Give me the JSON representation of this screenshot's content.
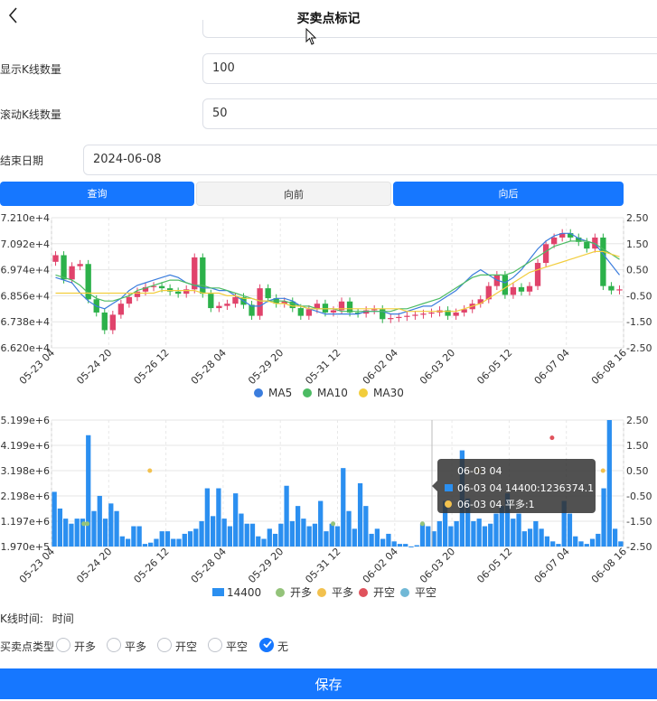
{
  "header": {
    "title": "买卖点标记"
  },
  "form": {
    "kline_count": {
      "label": "显示K线数量",
      "value": "100"
    },
    "scroll_count": {
      "label": "滚动K线数量",
      "value": "50"
    },
    "end_date": {
      "label": "结束日期",
      "value": "2024-06-08"
    }
  },
  "buttons": {
    "query": "查询",
    "forward": "向前",
    "backward": "向后",
    "save": "保存"
  },
  "colors": {
    "accent": "#1677ff",
    "candle_up": "#e0436b",
    "candle_down": "#2cb14a",
    "ma5": "#3b7ddd",
    "ma10": "#4cbb63",
    "ma30": "#f2cd3c",
    "vol_bar": "#2b8ff0",
    "open_long": "#94c37a",
    "close_long": "#f2c14e",
    "open_short": "#e0525c",
    "close_short": "#71b8d6"
  },
  "x_tick_labels": [
    "05-23 04",
    "05-24 20",
    "05-26 12",
    "05-28 04",
    "05-29 20",
    "05-31 12",
    "06-02 04",
    "06-03 20",
    "06-05 12",
    "06-07 04",
    "06-08 16"
  ],
  "chart_data": [
    {
      "type": "candlestick",
      "y_left_ticks": [
        "7.210e+4",
        "7.092e+4",
        "6.974e+4",
        "6.856e+4",
        "6.738e+4",
        "6.620e+4"
      ],
      "y_right_ticks": [
        "2.50",
        "1.50",
        "0.50",
        "-0.50",
        "-1.50",
        "-2.50"
      ],
      "ylim": [
        66200,
        72100
      ],
      "y_right_range": [
        -2.5,
        2.5
      ],
      "legend": [
        "MA5",
        "MA10",
        "MA30"
      ],
      "legend_position": "bottom",
      "close": [
        70400,
        69300,
        69900,
        70000,
        68400,
        67800,
        67000,
        67700,
        68200,
        68500,
        68750,
        68950,
        69000,
        68900,
        68750,
        68650,
        68850,
        70300,
        68650,
        68000,
        68100,
        68200,
        68500,
        68150,
        67650,
        68900,
        68450,
        68200,
        68300,
        68000,
        67650,
        67950,
        68200,
        67800,
        67900,
        68300,
        67800,
        67750,
        67900,
        67950,
        67500,
        67550,
        67600,
        67650,
        67700,
        67750,
        67800,
        67900,
        67650,
        67800,
        67950,
        68200,
        68400,
        69000,
        69500,
        68600,
        68950,
        68750,
        69000,
        70050,
        70900,
        71200,
        71400,
        71200,
        71000,
        70700,
        71200,
        69000,
        68800,
        68850
      ],
      "ma5": [
        0.2,
        0.1,
        0.0,
        -0.4,
        -0.7,
        -0.9,
        -1.0,
        -0.8,
        -0.6,
        -0.3,
        -0.1,
        0.0,
        0.1,
        0.2,
        0.3,
        0.2,
        0.0,
        -0.1,
        -0.2,
        -0.2,
        -0.3,
        -0.3,
        -0.5,
        -0.7,
        -0.9,
        -0.9,
        -0.7,
        -0.6,
        -0.6,
        -0.7,
        -0.9,
        -1.0,
        -1.1,
        -1.2,
        -1.2,
        -1.2,
        -1.2,
        -1.2,
        -1.1,
        -1.1,
        -1.1,
        -1.2,
        -1.2,
        -1.1,
        -1.0,
        -0.9,
        -0.9,
        -0.7,
        -0.5,
        -0.3,
        0.0,
        0.3,
        0.5,
        0.3,
        0.1,
        0.0,
        0.2,
        0.5,
        0.9,
        1.3,
        1.6,
        1.8,
        1.9,
        1.9,
        1.7,
        1.6,
        1.5,
        1.1,
        0.7,
        0.3
      ],
      "ma10": [
        0.3,
        0.2,
        0.1,
        -0.1,
        -0.4,
        -0.6,
        -0.7,
        -0.7,
        -0.6,
        -0.5,
        -0.3,
        -0.2,
        -0.1,
        0.0,
        0.1,
        0.1,
        0.0,
        -0.1,
        -0.1,
        -0.2,
        -0.2,
        -0.3,
        -0.4,
        -0.5,
        -0.6,
        -0.7,
        -0.7,
        -0.7,
        -0.7,
        -0.8,
        -0.9,
        -0.9,
        -1.0,
        -1.0,
        -1.0,
        -1.1,
        -1.1,
        -1.1,
        -1.1,
        -1.1,
        -1.1,
        -1.1,
        -1.0,
        -1.0,
        -0.9,
        -0.8,
        -0.7,
        -0.6,
        -0.4,
        -0.2,
        0.0,
        0.2,
        0.3,
        0.3,
        0.3,
        0.3,
        0.4,
        0.6,
        0.8,
        1.0,
        1.2,
        1.4,
        1.5,
        1.6,
        1.6,
        1.6,
        1.5,
        1.3,
        1.1,
        0.9
      ],
      "ma30": [
        -0.4,
        -0.4,
        -0.4,
        -0.4,
        -0.4,
        -0.4,
        -0.4,
        -0.4,
        -0.4,
        -0.4,
        -0.4,
        -0.4,
        -0.4,
        -0.3,
        -0.3,
        -0.3,
        -0.3,
        -0.3,
        -0.4,
        -0.4,
        -0.4,
        -0.5,
        -0.5,
        -0.6,
        -0.6,
        -0.7,
        -0.7,
        -0.8,
        -0.8,
        -0.9,
        -0.9,
        -1.0,
        -1.0,
        -1.0,
        -1.0,
        -1.0,
        -1.0,
        -1.0,
        -1.0,
        -1.0,
        -1.0,
        -1.0,
        -1.0,
        -1.1,
        -1.1,
        -1.1,
        -1.1,
        -1.1,
        -1.1,
        -1.1,
        -1.0,
        -0.9,
        -0.8,
        -0.6,
        -0.4,
        -0.2,
        0.0,
        0.2,
        0.4,
        0.5,
        0.6,
        0.7,
        0.8,
        0.9,
        1.0,
        1.1,
        1.2,
        1.2,
        1.1,
        1.0
      ]
    },
    {
      "type": "bar",
      "series_name": "14400",
      "y_left_ticks": [
        "5.199e+6",
        "4.199e+6",
        "3.198e+6",
        "2.198e+6",
        "1.197e+6",
        "1.970e+5"
      ],
      "y_right_ticks": [
        "2.50",
        "1.50",
        "0.50",
        "-0.50",
        "-1.50",
        "-2.50"
      ],
      "ylim": [
        197000,
        5199000
      ],
      "y_right_range": [
        -2.5,
        2.5
      ],
      "legend": [
        "14400",
        "开多",
        "平多",
        "开空",
        "平空"
      ],
      "legend_position": "bottom",
      "values": [
        2360000,
        1700000,
        1300000,
        1100000,
        1300000,
        1300000,
        4600000,
        1600000,
        2200000,
        1300000,
        1900000,
        1600000,
        600000,
        500000,
        1000000,
        1000000,
        300000,
        350000,
        500000,
        800000,
        800000,
        500000,
        500000,
        700000,
        800000,
        900000,
        1200000,
        2500000,
        1400000,
        2500000,
        1300000,
        1000000,
        2300000,
        1500000,
        1100000,
        1100000,
        600000,
        500000,
        900000,
        700000,
        1100000,
        2600000,
        1200000,
        1800000,
        1300000,
        1000000,
        1100000,
        2000000,
        800000,
        1100000,
        1000000,
        3300000,
        1600000,
        900000,
        2700000,
        1800000,
        700000,
        900000,
        500000,
        700000,
        400000,
        300000,
        300000,
        200000,
        250000,
        1100000,
        1000000,
        800000,
        1200000,
        2000000,
        1000000,
        1200000,
        4000000,
        2100000,
        1200000,
        1300000,
        1000000,
        1100000,
        1500000,
        1800000,
        2300000,
        1300000,
        1500000,
        800000,
        900000,
        1200000,
        900000,
        600000,
        400000,
        300000,
        2000000,
        1500000,
        600000,
        400000,
        300000,
        500000,
        700000,
        2500000,
        5199000,
        900000,
        400000
      ],
      "markers": [
        {
          "type": "开多",
          "x": 36,
          "y": -1.6
        },
        {
          "type": "开多",
          "x": 40,
          "y": -1.6
        },
        {
          "type": "平多",
          "x": 110,
          "y": 0.5
        },
        {
          "type": "开多",
          "x": 315,
          "y": -1.6
        },
        {
          "type": "开多",
          "x": 415,
          "y": -1.6
        },
        {
          "type": "平多",
          "x": 478,
          "y": 0.5
        },
        {
          "type": "开空",
          "x": 560,
          "y": 1.8
        },
        {
          "type": "平多",
          "x": 617,
          "y": 0.5
        }
      ],
      "tooltip": {
        "title": "06-03 04",
        "line1": "06-03 04 14400:1236374.1",
        "line2": "06-03 04 平多:1"
      }
    }
  ],
  "kline_time": {
    "label": "K线时间:",
    "value": "时间"
  },
  "point_type": {
    "label": "买卖点类型",
    "options": [
      "开多",
      "平多",
      "开空",
      "平空",
      "无"
    ],
    "selected": "无"
  }
}
